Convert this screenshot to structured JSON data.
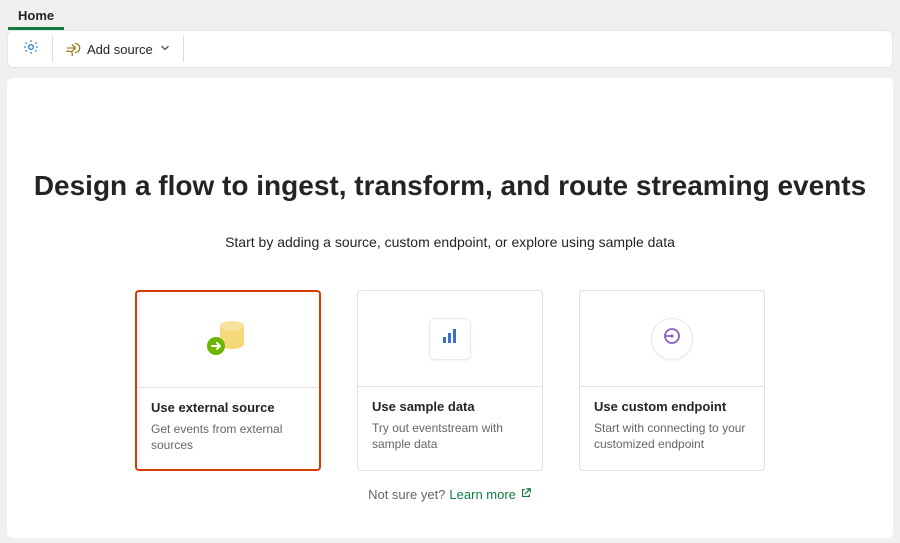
{
  "tab": {
    "label": "Home"
  },
  "toolbar": {
    "add_source_label": "Add source"
  },
  "hero": {
    "title": "Design a flow to ingest, transform, and route streaming events",
    "subtitle": "Start by adding a source, custom endpoint, or explore using sample data"
  },
  "cards": [
    {
      "title": "Use external source",
      "desc": "Get events from external sources",
      "icon": "external-source-icon",
      "highlighted": true
    },
    {
      "title": "Use sample data",
      "desc": "Try out eventstream with sample data",
      "icon": "sample-data-icon",
      "highlighted": false
    },
    {
      "title": "Use custom endpoint",
      "desc": "Start with connecting to your customized endpoint",
      "icon": "custom-endpoint-icon",
      "highlighted": false
    }
  ],
  "footer": {
    "prefix": "Not sure yet?",
    "link": "Learn more"
  }
}
